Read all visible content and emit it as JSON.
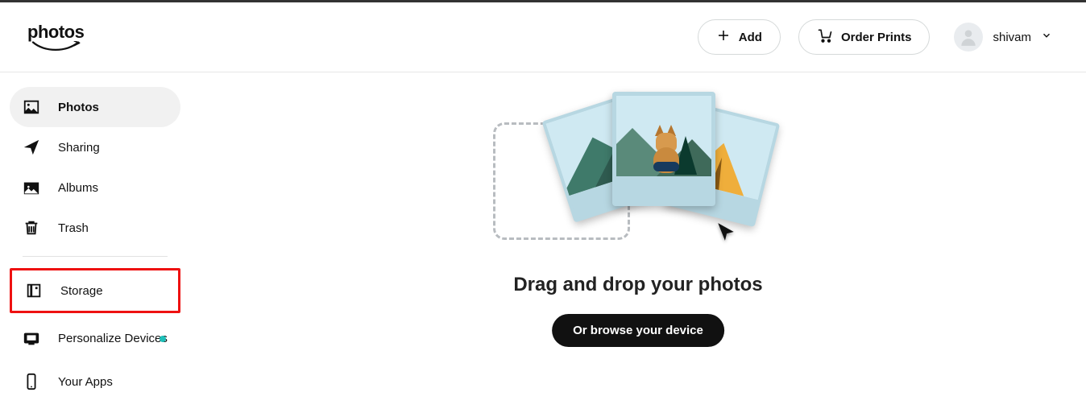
{
  "header": {
    "logo_text": "photos",
    "add_label": "Add",
    "order_prints_label": "Order Prints",
    "account_name": "shivam"
  },
  "sidebar": {
    "photos": "Photos",
    "sharing": "Sharing",
    "albums": "Albums",
    "trash": "Trash",
    "storage": "Storage",
    "personalize_devices": "Personalize Devices",
    "your_apps": "Your Apps"
  },
  "content": {
    "headline": "Drag and drop your photos",
    "browse_button": "Or browse your device"
  }
}
